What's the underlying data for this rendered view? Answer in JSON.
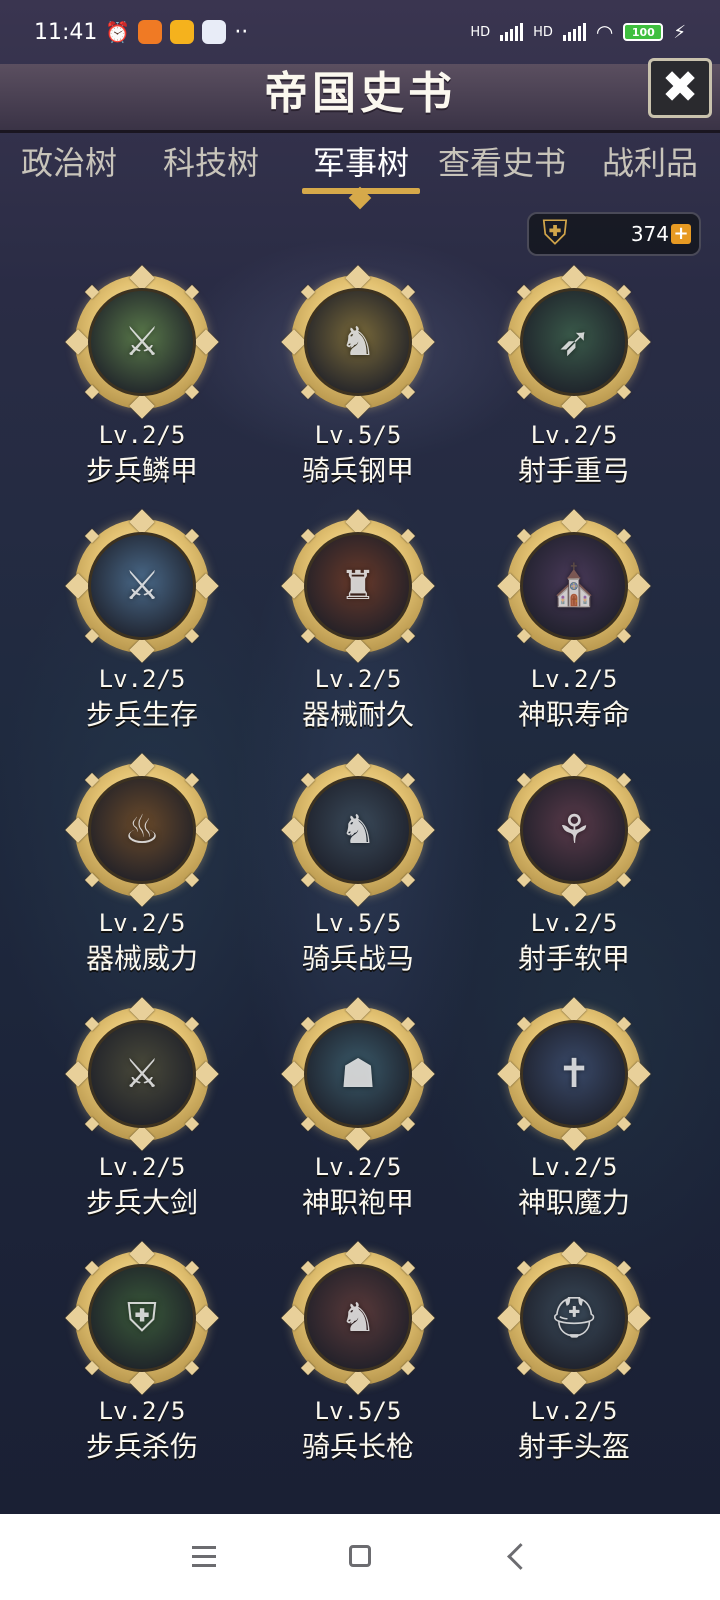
{
  "status_bar": {
    "time": "11:41",
    "battery": "100",
    "network_1": "HD",
    "network_2": "HD"
  },
  "header": {
    "title": "帝国史书",
    "close_icon": "close-icon"
  },
  "tabs": [
    {
      "label": "政治树",
      "active": false
    },
    {
      "label": "科技树",
      "active": false
    },
    {
      "label": "军事树",
      "active": true
    },
    {
      "label": "查看史书",
      "active": false
    },
    {
      "label": "战利品",
      "active": false
    }
  ],
  "currency": {
    "amount": "374",
    "emblem_icon": "crest-icon",
    "add_icon": "plus-icon"
  },
  "skills": [
    {
      "level": "Lv.2/5",
      "name": "步兵鳞甲",
      "icon": "infantry-knights-icon",
      "color": "#5a7a4a"
    },
    {
      "level": "Lv.5/5",
      "name": "骑兵钢甲",
      "icon": "cavalry-rider-icon",
      "color": "#7a6a3a"
    },
    {
      "level": "Lv.2/5",
      "name": "射手重弓",
      "icon": "archer-soldiers-icon",
      "color": "#3a5a4a"
    },
    {
      "level": "Lv.2/5",
      "name": "步兵生存",
      "icon": "infantry-survivor-icon",
      "color": "#4a6a8a"
    },
    {
      "level": "Lv.2/5",
      "name": "器械耐久",
      "icon": "burning-castle-icon",
      "color": "#6a3a2a"
    },
    {
      "level": "Lv.2/5",
      "name": "神职寿命",
      "icon": "cathedral-interior-icon",
      "color": "#4a3a5a"
    },
    {
      "level": "Lv.2/5",
      "name": "器械威力",
      "icon": "forge-fire-icon",
      "color": "#6a4a2a"
    },
    {
      "level": "Lv.5/5",
      "name": "骑兵战马",
      "icon": "war-horse-icon",
      "color": "#3a4a5a"
    },
    {
      "level": "Lv.2/5",
      "name": "射手软甲",
      "icon": "forest-ruin-icon",
      "color": "#5a3a4a"
    },
    {
      "level": "Lv.2/5",
      "name": "步兵大剑",
      "icon": "greatsword-knight-icon",
      "color": "#4a4a3a"
    },
    {
      "level": "Lv.2/5",
      "name": "神职袍甲",
      "icon": "robed-monk-icon",
      "color": "#3a5a6a"
    },
    {
      "level": "Lv.2/5",
      "name": "神职魔力",
      "icon": "priest-council-icon",
      "color": "#3a4a6a"
    },
    {
      "level": "Lv.2/5",
      "name": "步兵杀伤",
      "icon": "shield-warrior-icon",
      "color": "#3a5a3a"
    },
    {
      "level": "Lv.5/5",
      "name": "骑兵长枪",
      "icon": "lancer-knight-icon",
      "color": "#5a3a3a"
    },
    {
      "level": "Lv.2/5",
      "name": "射手头盔",
      "icon": "helmet-archer-icon",
      "color": "#3a4a5a"
    }
  ],
  "nav_bar": {
    "menu_icon": "menu-icon",
    "home_icon": "home-icon",
    "back_icon": "back-icon"
  }
}
